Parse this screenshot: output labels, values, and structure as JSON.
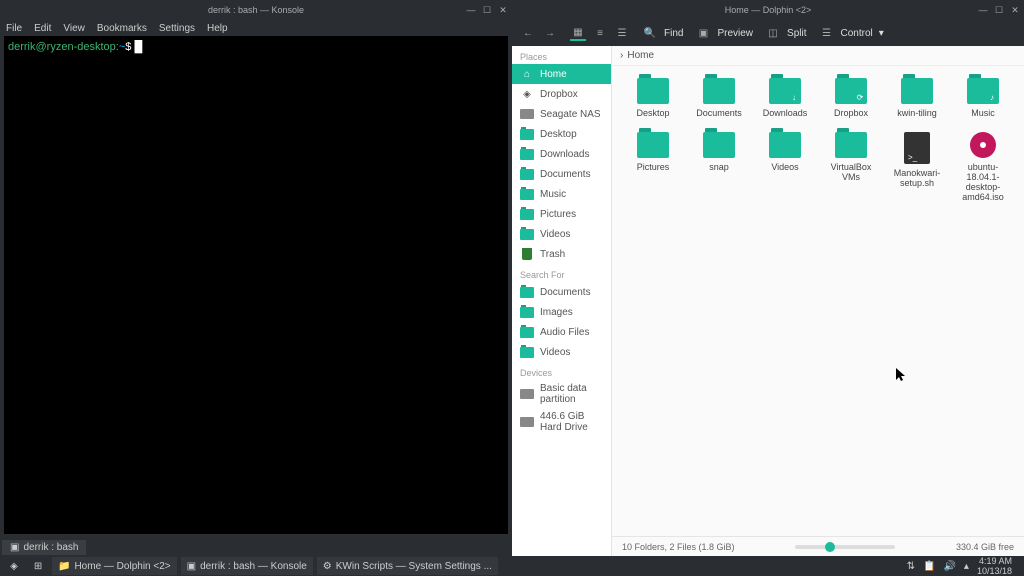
{
  "konsole": {
    "title": "derrik : bash — Konsole",
    "menu": [
      "File",
      "Edit",
      "View",
      "Bookmarks",
      "Settings",
      "Help"
    ],
    "prompt_user": "derrik@ryzen-desktop",
    "prompt_path": "~",
    "prompt_symbol": "$",
    "tab_label": "derrik : bash"
  },
  "dolphin": {
    "title": "Home — Dolphin <2>",
    "toolbar": {
      "find": "Find",
      "preview": "Preview",
      "split": "Split",
      "control": "Control"
    },
    "path": "Home",
    "sidebar": {
      "places_header": "Places",
      "places": [
        "Home",
        "Dropbox",
        "Seagate NAS",
        "Desktop",
        "Downloads",
        "Documents",
        "Music",
        "Pictures",
        "Videos",
        "Trash"
      ],
      "search_header": "Search For",
      "search": [
        "Documents",
        "Images",
        "Audio Files",
        "Videos"
      ],
      "devices_header": "Devices",
      "devices": [
        "Basic data partition",
        "446.6 GiB Hard Drive"
      ]
    },
    "files": [
      {
        "name": "Desktop",
        "type": "folder"
      },
      {
        "name": "Documents",
        "type": "folder"
      },
      {
        "name": "Downloads",
        "type": "folder",
        "badge": "↓"
      },
      {
        "name": "Dropbox",
        "type": "folder",
        "badge": "⟳"
      },
      {
        "name": "kwin-tiling",
        "type": "folder"
      },
      {
        "name": "Music",
        "type": "folder",
        "badge": "♪"
      },
      {
        "name": "Pictures",
        "type": "folder"
      },
      {
        "name": "snap",
        "type": "folder"
      },
      {
        "name": "Videos",
        "type": "folder"
      },
      {
        "name": "VirtualBox VMs",
        "type": "folder"
      },
      {
        "name": "Manokwari-setup.sh",
        "type": "sh"
      },
      {
        "name": "ubuntu-18.04.1-desktop-amd64.iso",
        "type": "iso"
      }
    ],
    "status": "10 Folders, 2 Files (1.8 GiB)",
    "free_space": "330.4 GiB free"
  },
  "taskbar": {
    "tasks": [
      {
        "label": "Home — Dolphin <2>"
      },
      {
        "label": "derrik : bash — Konsole"
      },
      {
        "label": "KWin Scripts — System Settings ..."
      }
    ],
    "time": "4:19 AM",
    "date": "10/13/18"
  }
}
